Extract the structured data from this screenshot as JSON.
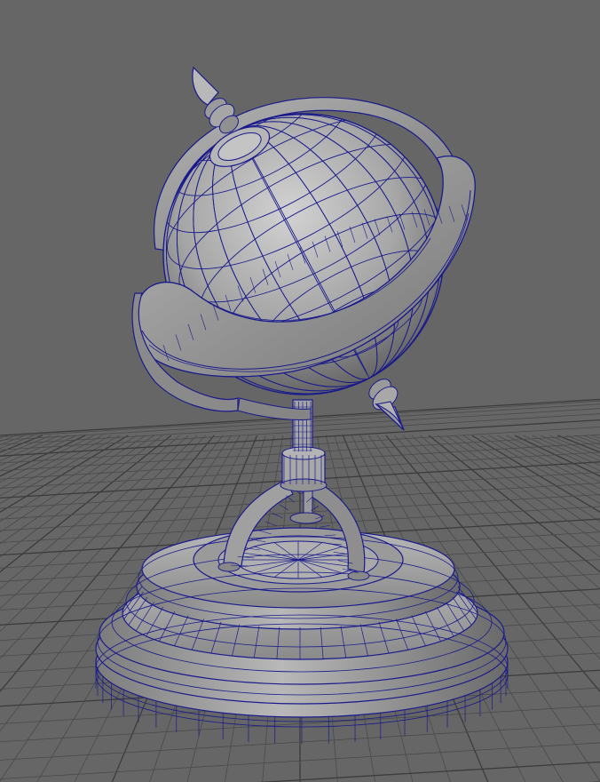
{
  "viewport": {
    "background_color": "#666666",
    "grid_color": "#4a4a4a",
    "grid_major_color": "#3c3c3c",
    "wireframe_color": "#1a1a8c",
    "shade_light": "#c8c8c8",
    "shade_dark": "#6e6e6e"
  },
  "model": {
    "parts": [
      "globe-sphere",
      "meridian-ring",
      "equator-ring",
      "top-finial",
      "bottom-finial",
      "stem",
      "tripod-arms",
      "round-base"
    ]
  }
}
